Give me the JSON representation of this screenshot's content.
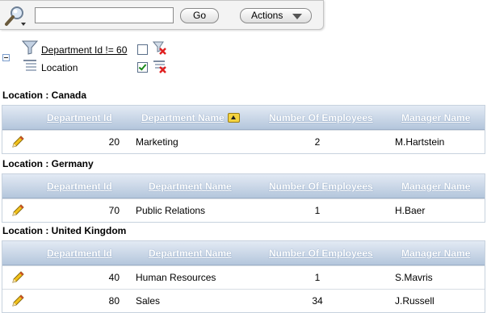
{
  "toolbar": {
    "search_value": "",
    "go_label": "Go",
    "actions_label": "Actions"
  },
  "filters": {
    "filter_text": "Department Id != 60",
    "break_text": "Location"
  },
  "columns": {
    "dept_id": "Department Id",
    "dept_name": "Department Name",
    "employees": "Number Of Employees",
    "manager": "Manager Name"
  },
  "groups": [
    {
      "title": "Location : Canada",
      "rows": [
        {
          "id": "20",
          "name": "Marketing",
          "employees": "2",
          "manager": "M.Hartstein"
        }
      ]
    },
    {
      "title": "Location : Germany",
      "rows": [
        {
          "id": "70",
          "name": "Public Relations",
          "employees": "1",
          "manager": "H.Baer"
        }
      ]
    },
    {
      "title": "Location : United Kingdom",
      "rows": [
        {
          "id": "40",
          "name": "Human Resources",
          "employees": "1",
          "manager": "S.Mavris"
        },
        {
          "id": "80",
          "name": "Sales",
          "employees": "34",
          "manager": "J.Russell"
        }
      ]
    }
  ],
  "colors": {
    "header_top": "#e3eaf4",
    "header_bottom": "#b4c6dc",
    "border": "#c7d2de"
  }
}
